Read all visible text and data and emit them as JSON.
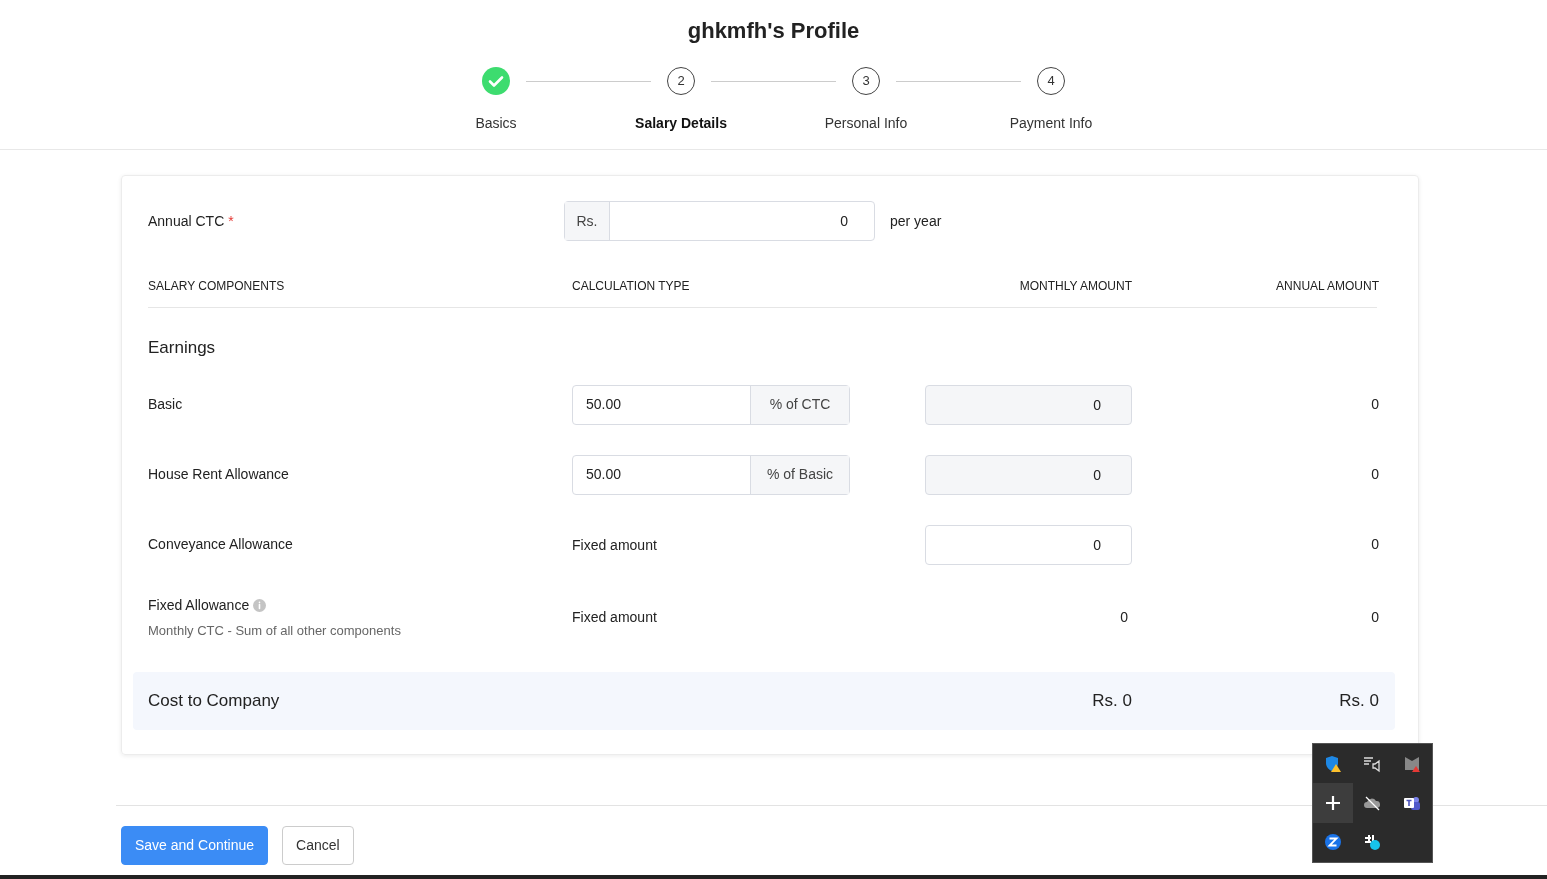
{
  "title": "ghkmfh's Profile",
  "steps": [
    {
      "label": "Basics",
      "completed": true,
      "selected": false
    },
    {
      "number": "2",
      "label": "Salary Details",
      "completed": false,
      "selected": true
    },
    {
      "number": "3",
      "label": "Personal Info",
      "completed": false,
      "selected": false
    },
    {
      "number": "4",
      "label": "Payment Info",
      "completed": false,
      "selected": false
    }
  ],
  "annual_ctc": {
    "label": "Annual CTC",
    "required_mark": "*",
    "prefix": "Rs.",
    "value": "0",
    "suffix": "per year"
  },
  "columns": [
    "SALARY COMPONENTS",
    "CALCULATION TYPE",
    "MONTHLY AMOUNT",
    "ANNUAL AMOUNT"
  ],
  "section": "Earnings",
  "components": [
    {
      "kind": "percent",
      "name": "Basic",
      "rate": "50.00",
      "unit": "% of CTC",
      "monthly": "0",
      "annual": "0"
    },
    {
      "kind": "percent",
      "name": "House Rent Allowance",
      "rate": "50.00",
      "unit": "% of Basic",
      "monthly": "0",
      "annual": "0"
    },
    {
      "kind": "fixed",
      "name": "Conveyance Allowance",
      "calc": "Fixed amount",
      "monthly": "0",
      "annual": "0"
    },
    {
      "kind": "computed",
      "name": "Fixed Allowance",
      "info": true,
      "note": "Monthly CTC - Sum of all other components",
      "calc": "Fixed amount",
      "monthly": "0",
      "annual": "0"
    }
  ],
  "total": {
    "label": "Cost to Company",
    "monthly": "Rs. 0",
    "annual": "Rs. 0"
  },
  "buttons": [
    {
      "label": "Save and Continue",
      "kind": "primary"
    },
    {
      "label": "Cancel",
      "kind": "secondary"
    }
  ]
}
